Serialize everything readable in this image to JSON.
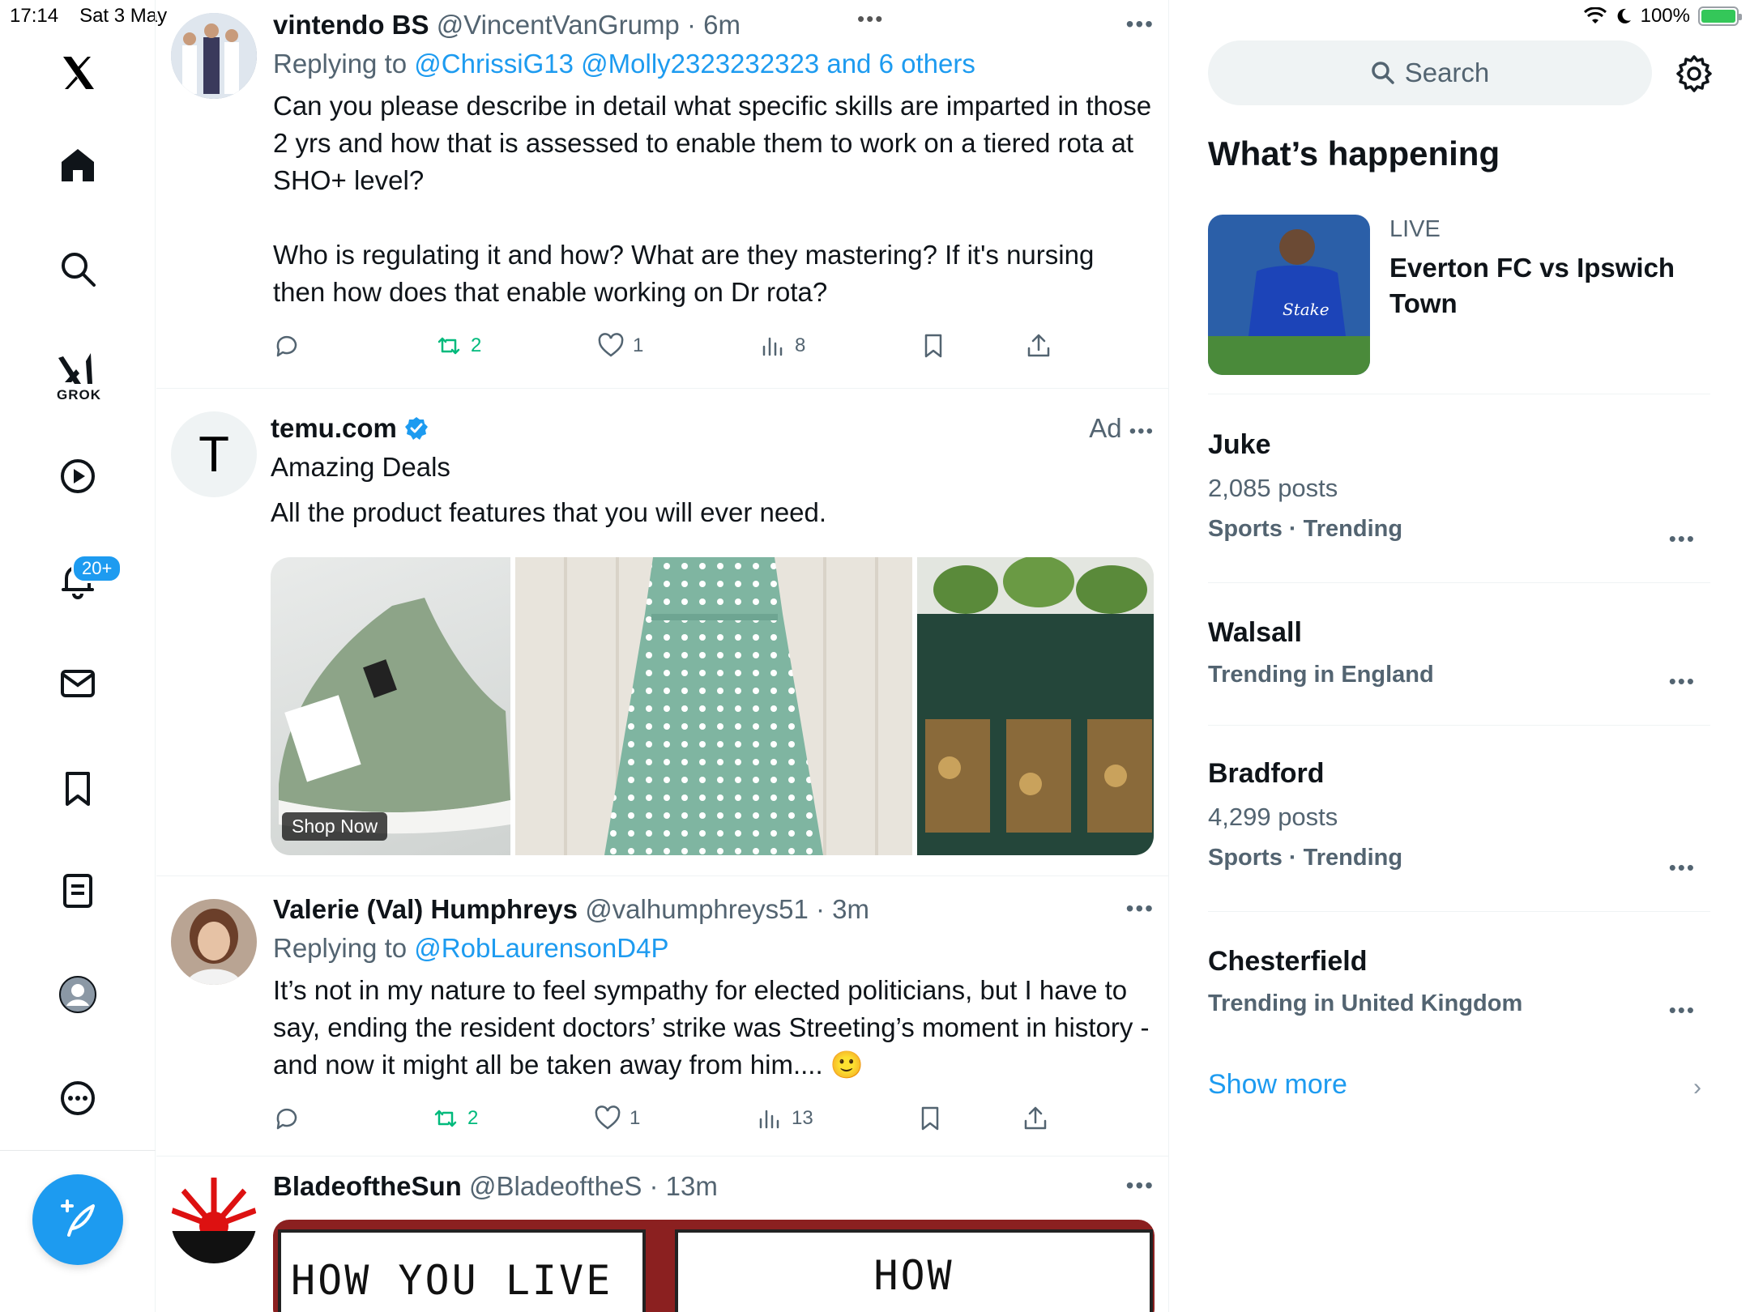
{
  "status_bar": {
    "time": "17:14",
    "date": "Sat 3 May",
    "battery": "100%"
  },
  "nav": {
    "grok_label": "GROK",
    "notifications_badge": "20+"
  },
  "posts": [
    {
      "name": "vintendo BS",
      "handle": "@VincentVanGrump",
      "time": "6m",
      "replying_prefix": "Replying to ",
      "replying_to": "@ChrissiG13 @Molly2323232323 and 6 others",
      "text": "Can you please describe in detail what specific skills are imparted in those 2 yrs and how that is assessed to enable them to work on a tiered rota at SHO+ level?\n\nWho is regulating it and how? What are they mastering? If it's nursing then how does that enable working on Dr rota?",
      "reposts": "2",
      "likes": "1",
      "views": "8"
    },
    {
      "name": "temu.com",
      "subtitle": "Amazing Deals",
      "ad_label": "Ad",
      "text": "All the product features that you will ever need.",
      "cta": "Shop Now"
    },
    {
      "name": "Valerie (Val) Humphreys",
      "handle": "@valhumphreys51",
      "time": "3m",
      "replying_prefix": "Replying to ",
      "replying_to": "@RobLaurensonD4P",
      "text": "It’s not in my nature to feel sympathy for elected politicians, but I have to say, ending the resident doctors’ strike was Streeting’s moment in history - and now it might all be taken away from him.... 🙂",
      "reposts": "2",
      "likes": "1",
      "views": "13"
    },
    {
      "name": "BladeoftheSun",
      "handle": "@BladeoftheS",
      "time": "13m",
      "meme_left": "HOW YOU LIVE",
      "meme_right": "HOW"
    }
  ],
  "sidebar": {
    "search_placeholder": "Search",
    "heading": "What’s happening",
    "live": {
      "label": "LIVE",
      "title": "Everton FC vs Ipswich Town"
    },
    "trends": [
      {
        "name": "Juke",
        "posts": "2,085 posts",
        "category": "Sports · Trending"
      },
      {
        "name": "Walsall",
        "category": "Trending in England"
      },
      {
        "name": "Bradford",
        "posts": "4,299 posts",
        "category": "Sports · Trending"
      },
      {
        "name": "Chesterfield",
        "category": "Trending in United Kingdom"
      }
    ],
    "show_more": "Show more"
  },
  "colors": {
    "accent": "#1d9bf0",
    "repost": "#00ba7c",
    "muted": "#536471"
  }
}
